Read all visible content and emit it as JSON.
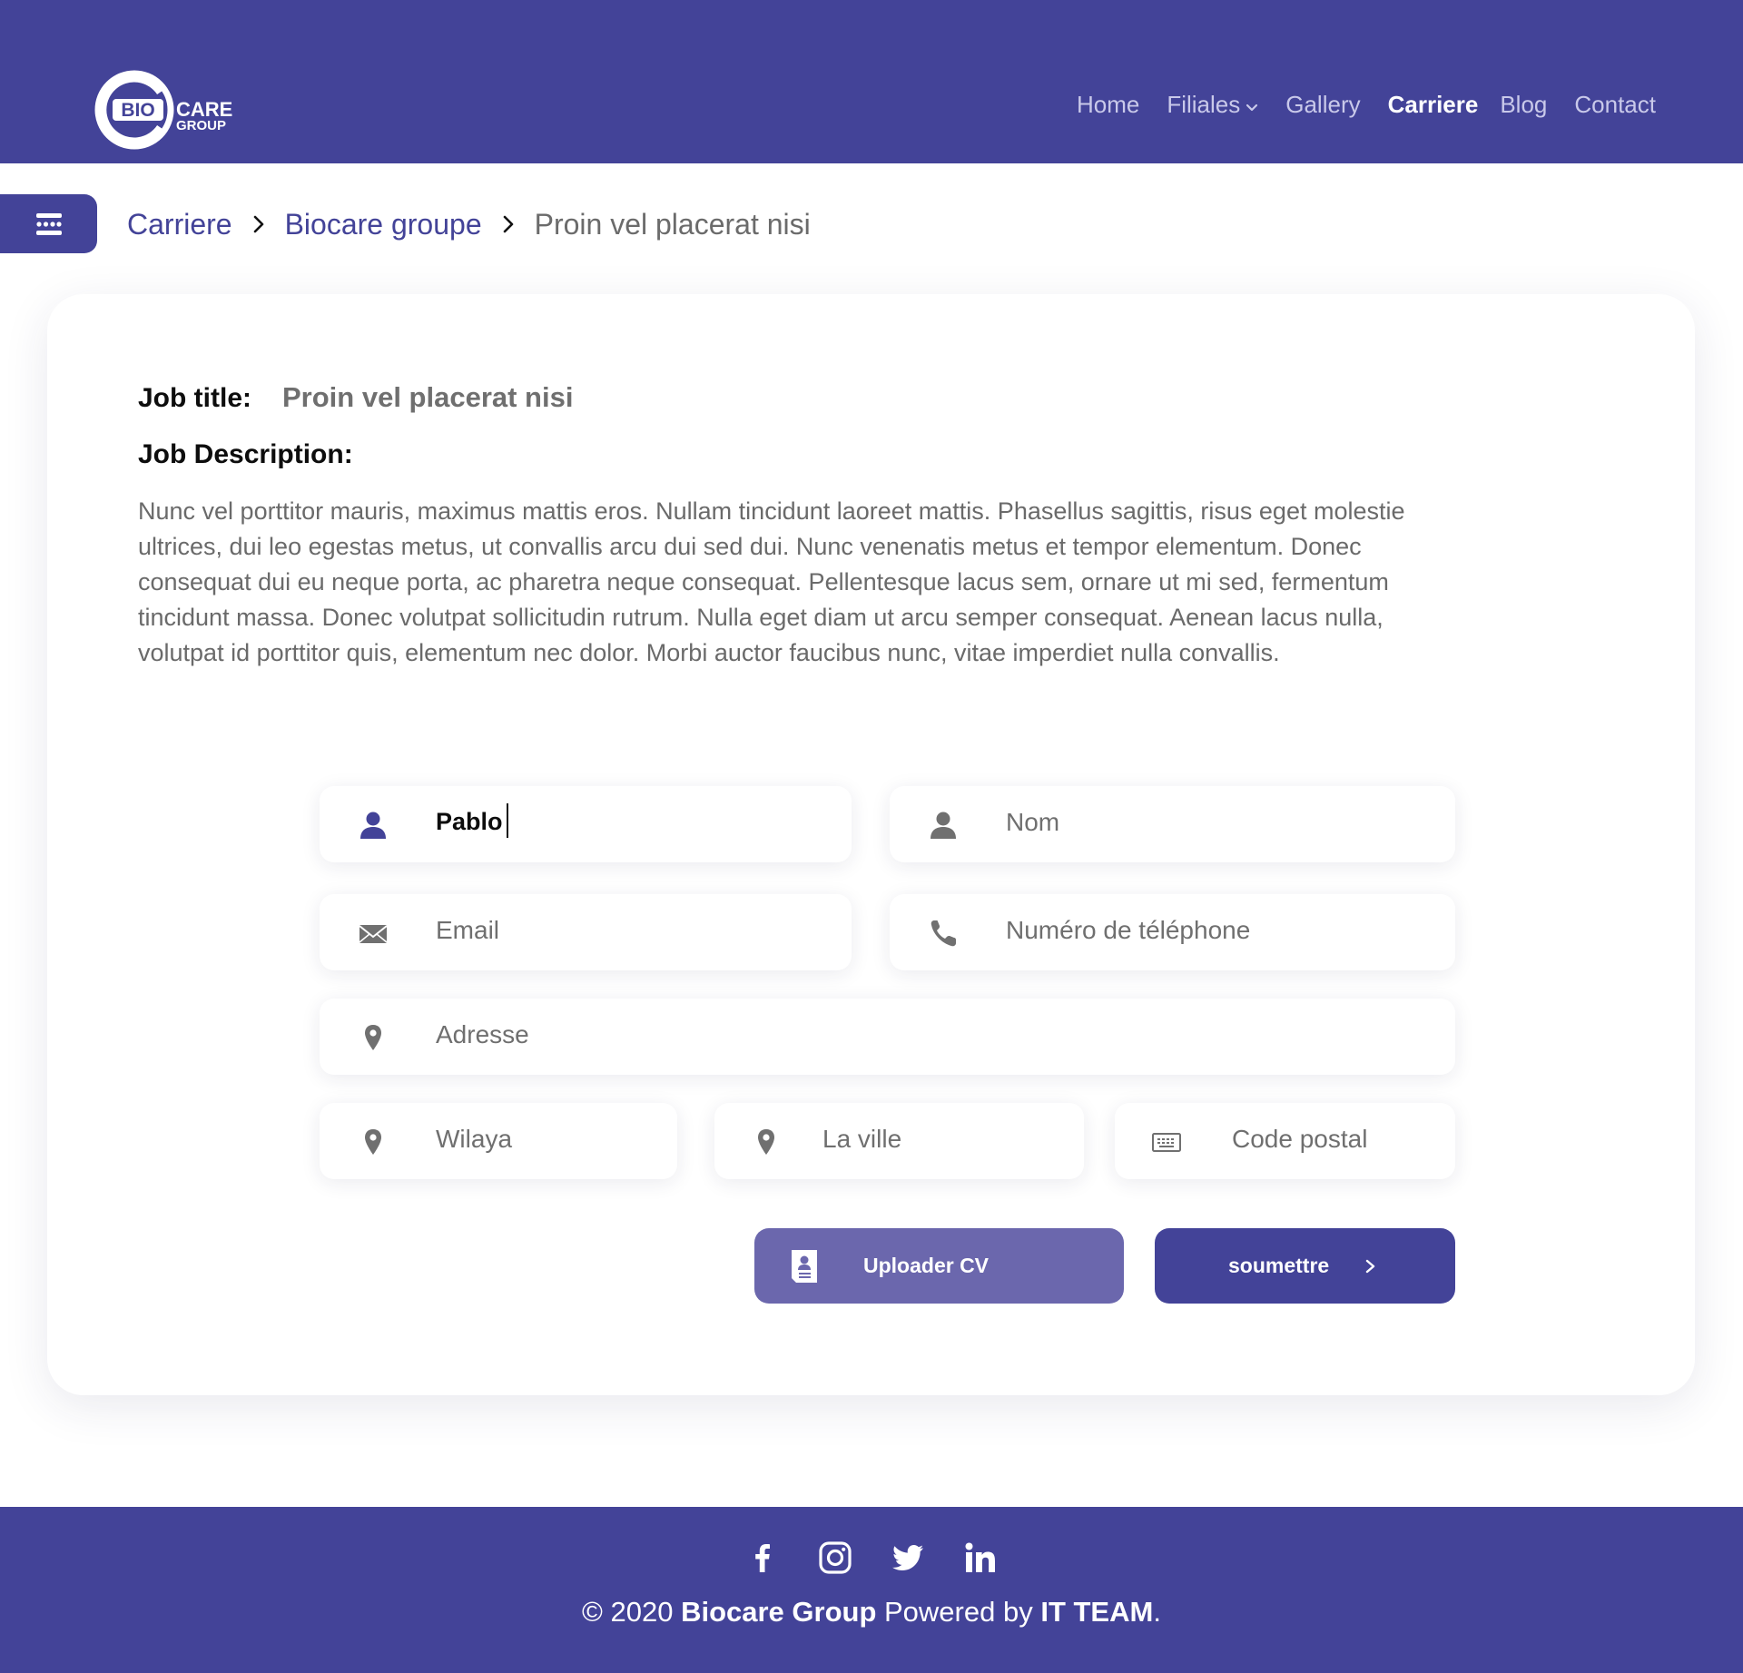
{
  "brand": {
    "logo_alt": "Biocare Group",
    "logo_bio": "BIO",
    "logo_care": "CARE",
    "logo_group": "GROUP",
    "primary_color": "#434398",
    "secondary_color": "#6b67ad"
  },
  "nav": {
    "items": [
      {
        "label": "Home",
        "active": false
      },
      {
        "label": "Filiales",
        "active": false,
        "has_dropdown": true
      },
      {
        "label": "Gallery",
        "active": false
      },
      {
        "label": "Carriere",
        "active": true
      },
      {
        "label": "Blog",
        "active": false
      },
      {
        "label": "Contact",
        "active": false
      }
    ]
  },
  "breadcrumb": {
    "items": [
      "Carriere",
      "Biocare groupe",
      "Proin vel placerat nisi"
    ]
  },
  "job": {
    "title_label": "Job title:",
    "title_value": "Proin vel placerat nisi",
    "description_label": "Job Description:",
    "description": "Nunc vel porttitor mauris, maximus mattis eros. Nullam tincidunt laoreet mattis. Phasellus sagittis, risus eget molestie ultrices, dui leo egestas metus, ut convallis arcu dui sed dui. Nunc venenatis metus et tempor elementum. Donec consequat dui eu neque porta, ac pharetra neque consequat. Pellentesque lacus sem, ornare ut mi sed, fermentum tincidunt massa. Donec volutpat sollicitudin rutrum. Nulla eget diam ut arcu semper consequat. Aenean lacus nulla, volutpat id porttitor quis, elementum nec dolor. Morbi auctor faucibus nunc, vitae imperdiet nulla convallis."
  },
  "form": {
    "prenom": {
      "value": "Pablo",
      "icon": "user-icon"
    },
    "nom": {
      "placeholder": "Nom",
      "icon": "user-icon"
    },
    "email": {
      "placeholder": "Email",
      "icon": "envelope-icon"
    },
    "telephone": {
      "placeholder": "Numéro de téléphone",
      "icon": "phone-icon"
    },
    "adresse": {
      "placeholder": "Adresse",
      "icon": "map-pin-icon"
    },
    "wilaya": {
      "placeholder": "Wilaya",
      "icon": "map-pin-icon"
    },
    "ville": {
      "placeholder": "La ville",
      "icon": "map-pin-icon"
    },
    "code_postal": {
      "placeholder": "Code postal",
      "icon": "keyboard-icon"
    },
    "upload_label": "Uploader CV",
    "submit_label": "soumettre"
  },
  "footer": {
    "socials": [
      "facebook-icon",
      "instagram-icon",
      "twitter-icon",
      "linkedin-icon"
    ],
    "copyright_prefix": "© 2020 ",
    "company": "Biocare Group",
    "powered_by": " Powered by ",
    "team": "IT TEAM",
    "suffix": "."
  }
}
